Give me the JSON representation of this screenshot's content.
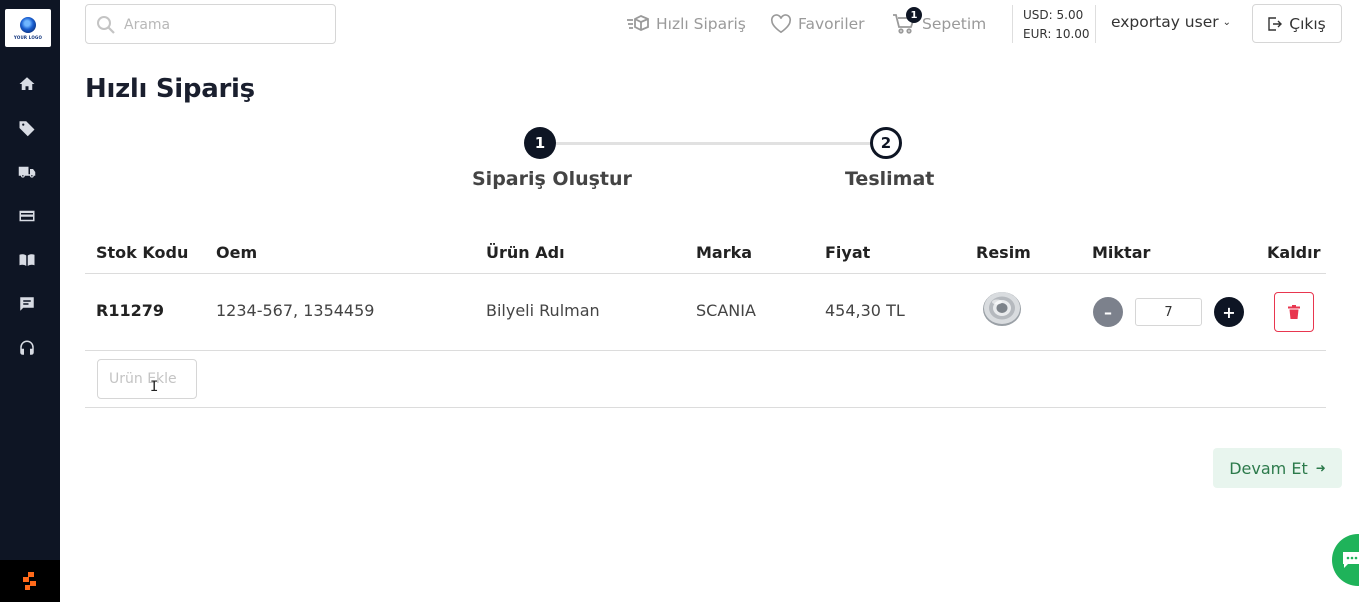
{
  "brand": {
    "logo_text": "YOUR LOGO"
  },
  "sidebar": {
    "items": [
      {
        "icon": "home-icon"
      },
      {
        "icon": "tag-icon"
      },
      {
        "icon": "truck-icon"
      },
      {
        "icon": "credit-card-icon"
      },
      {
        "icon": "book-icon"
      },
      {
        "icon": "chat-icon"
      },
      {
        "icon": "headset-icon"
      }
    ]
  },
  "header": {
    "search_placeholder": "Arama",
    "quick_order_label": "Hızlı Sipariş",
    "favorites_label": "Favoriler",
    "cart_label": "Sepetim",
    "cart_count": "1",
    "usd_rate": "USD: 5.00",
    "eur_rate": "EUR: 10.00",
    "user_name": "exportay user",
    "logout_label": "Çıkış"
  },
  "page": {
    "title": "Hızlı Sipariş"
  },
  "stepper": {
    "steps": [
      {
        "number": "1",
        "label": "Sipariş Oluştur"
      },
      {
        "number": "2",
        "label": "Teslimat"
      }
    ]
  },
  "table": {
    "columns": [
      "Stok Kodu",
      "Oem",
      "Ürün Adı",
      "Marka",
      "Fiyat",
      "Resim",
      "Miktar",
      "Kaldır"
    ],
    "rows": [
      {
        "stock_code": "R11279",
        "oem": "1234-567, 1354459",
        "product_name": "Bilyeli Rulman",
        "brand": "SCANIA",
        "price": "454,30 TL",
        "quantity": "7"
      }
    ],
    "add_product_placeholder": "Ürün Ekle"
  },
  "actions": {
    "continue_label": "Devam Et"
  },
  "colors": {
    "sidebar_bg": "#0e1524",
    "primary": "#0e1524",
    "danger": "#e8364f",
    "success_bg": "#e8f5ee",
    "success_text": "#2c7a4b",
    "chat_fab": "#1fb35a"
  }
}
